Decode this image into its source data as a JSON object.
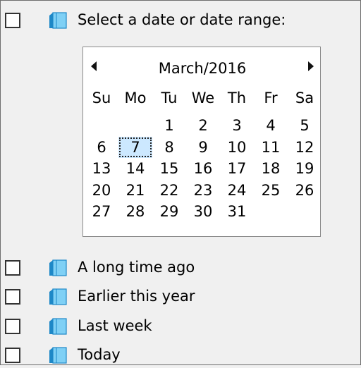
{
  "items": [
    {
      "label": "Select a date or date range:"
    },
    {
      "label": "A long time ago"
    },
    {
      "label": "Earlier this year"
    },
    {
      "label": "Last week"
    },
    {
      "label": "Today"
    }
  ],
  "calendar": {
    "title": "March/2016",
    "weekdays": [
      "Su",
      "Mo",
      "Tu",
      "We",
      "Th",
      "Fr",
      "Sa"
    ],
    "weeks": [
      [
        "",
        "",
        "1",
        "2",
        "3",
        "4",
        "5"
      ],
      [
        "6",
        "7",
        "8",
        "9",
        "10",
        "11",
        "12"
      ],
      [
        "13",
        "14",
        "15",
        "16",
        "17",
        "18",
        "19"
      ],
      [
        "20",
        "21",
        "22",
        "23",
        "24",
        "25",
        "26"
      ],
      [
        "27",
        "28",
        "29",
        "30",
        "31",
        "",
        ""
      ]
    ],
    "selected_day": "7"
  },
  "colors": {
    "selection": "#cce8ff",
    "icon_light": "#7fd0f5",
    "icon_dark": "#1e88c7"
  },
  "icons": {
    "item": "stack-icon",
    "prev": "triangle-left-icon",
    "next": "triangle-right-icon"
  }
}
